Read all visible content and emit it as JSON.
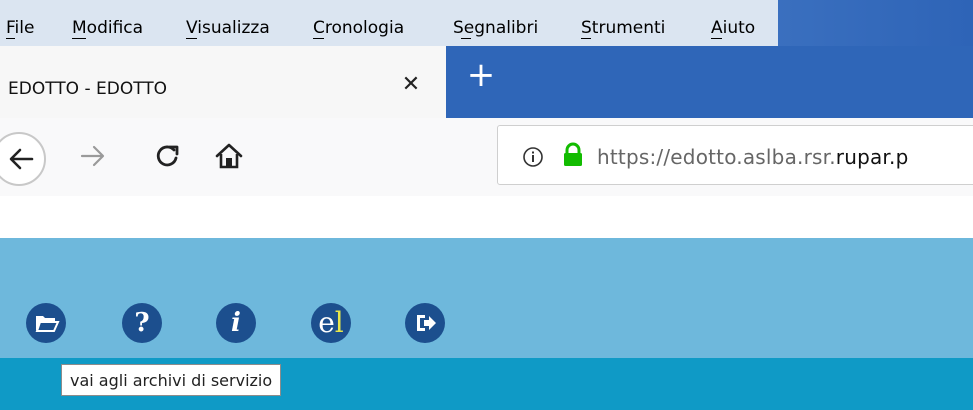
{
  "menubar": {
    "items": [
      {
        "label": "File"
      },
      {
        "label": "Modifica"
      },
      {
        "label": "Visualizza"
      },
      {
        "label": "Cronologia"
      },
      {
        "label": "Segnalibri"
      },
      {
        "label": "Strumenti"
      },
      {
        "label": "Aiuto"
      }
    ]
  },
  "tab": {
    "title": "EDOTTO - EDOTTO",
    "close_icon": "close-icon"
  },
  "newtab": {
    "icon": "plus-icon"
  },
  "nav": {
    "back_icon": "arrow-left-icon",
    "forward_icon": "arrow-right-icon",
    "reload_icon": "reload-icon",
    "home_icon": "home-icon"
  },
  "urlbar": {
    "info_icon": "info-icon",
    "lock_icon": "lock-icon",
    "url_prefix": "https://edotto.aslba.rsr.",
    "url_host": "rupar.p",
    "lock_color": "#12bc00"
  },
  "toolbar": {
    "items": [
      {
        "name": "archive",
        "icon": "folder-open-icon"
      },
      {
        "name": "help",
        "icon": "question-icon",
        "glyph": "?"
      },
      {
        "name": "info",
        "icon": "info-i-icon",
        "glyph": "i"
      },
      {
        "name": "el",
        "icon": "el-icon",
        "glyph_e": "e",
        "glyph_l": "l"
      },
      {
        "name": "logout",
        "icon": "exit-icon"
      }
    ],
    "tooltip": "vai agli archivi di servizio",
    "icon_bg": "#1c4f8e"
  }
}
